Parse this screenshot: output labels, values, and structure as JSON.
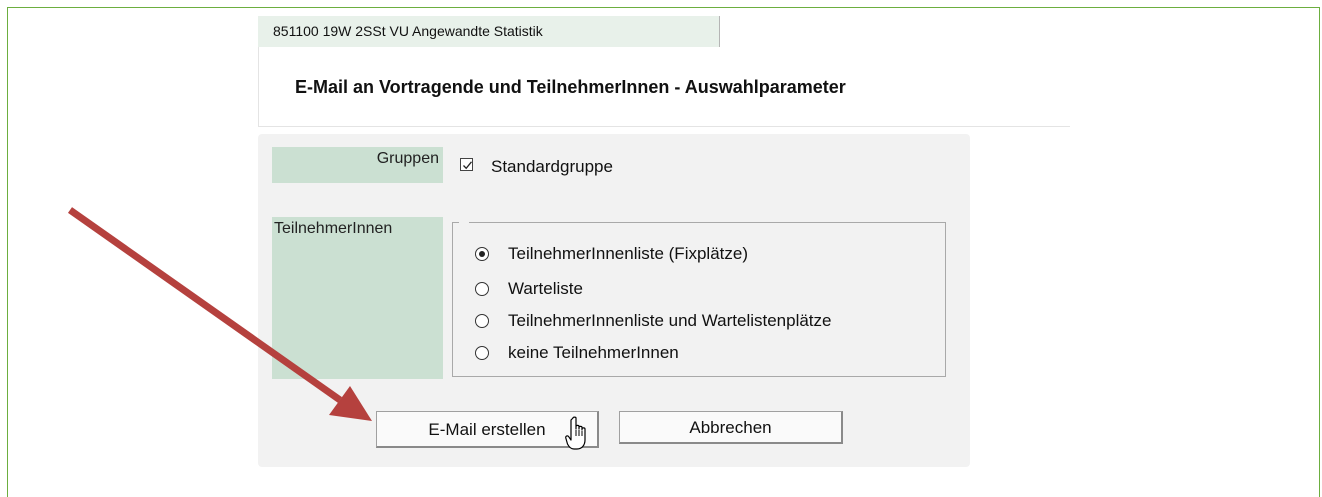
{
  "course": {
    "tab_label": "851100 19W 2SSt VU Angewandte Statistik"
  },
  "page": {
    "title": "E-Mail an Vortragende und TeilnehmerInnen - Auswahlparameter"
  },
  "form": {
    "groups": {
      "label": "Gruppen",
      "option": "Standardgruppe",
      "checked": true
    },
    "participants": {
      "label": "TeilnehmerInnen",
      "options": [
        {
          "label": "TeilnehmerInnenliste (Fixplätze)",
          "checked": true
        },
        {
          "label": "Warteliste",
          "checked": false
        },
        {
          "label": "TeilnehmerInnenliste und Wartelistenplätze",
          "checked": false
        },
        {
          "label": "keine TeilnehmerInnen",
          "checked": false
        }
      ]
    }
  },
  "actions": {
    "create_label": "E-Mail erstellen",
    "cancel_label": "Abbrechen"
  },
  "annotation": {
    "arrow_color": "#b5413e",
    "border_color": "#6cae3f"
  }
}
